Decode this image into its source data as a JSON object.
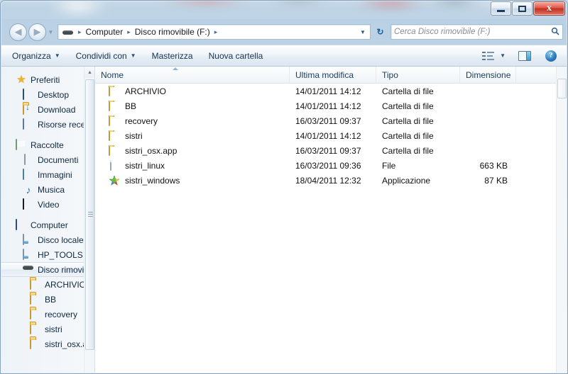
{
  "window": {
    "controls": {
      "minimize": "—",
      "maximize": "□",
      "close": "x"
    }
  },
  "address_bar": {
    "back_icon": "◀",
    "forward_icon": "▶",
    "history_caret": "▼",
    "drive_icon": "usb-drive-icon",
    "crumbs": [
      {
        "label": "Computer"
      },
      {
        "label": "Disco rimovibile (F:)"
      }
    ],
    "separator": "▸",
    "dropdown_caret": "▼",
    "refresh_icon": "↻"
  },
  "search": {
    "placeholder": "Cerca Disco rimovibile (F:)",
    "icon": "🔍"
  },
  "toolbar": {
    "items": [
      {
        "label": "Organizza",
        "caret": "▼"
      },
      {
        "label": "Condividi con",
        "caret": "▼"
      },
      {
        "label": "Masterizza",
        "caret": ""
      },
      {
        "label": "Nuova cartella",
        "caret": ""
      }
    ],
    "views_caret": "▼",
    "help_glyph": "?"
  },
  "navigation_pane": {
    "groups": [
      {
        "head": {
          "label": "Preferiti",
          "icon": "star-icon"
        },
        "children": [
          {
            "label": "Desktop",
            "icon": "desktop-icon"
          },
          {
            "label": "Download",
            "icon": "download-folder-icon"
          },
          {
            "label": "Risorse recent",
            "icon": "recent-places-icon"
          }
        ]
      },
      {
        "head": {
          "label": "Raccolte",
          "icon": "libraries-icon"
        },
        "children": [
          {
            "label": "Documenti",
            "icon": "document-icon"
          },
          {
            "label": "Immagini",
            "icon": "picture-icon"
          },
          {
            "label": "Musica",
            "icon": "music-note-icon"
          },
          {
            "label": "Video",
            "icon": "video-icon"
          }
        ]
      },
      {
        "head": {
          "label": "Computer",
          "icon": "computer-icon"
        },
        "children": [
          {
            "label": "Disco locale (",
            "icon": "hard-disk-icon"
          },
          {
            "label": "HP_TOOLS (D",
            "icon": "hard-disk-icon"
          },
          {
            "label": "Disco rimovib",
            "icon": "usb-drive-icon",
            "selected": true
          }
        ],
        "subchildren": [
          {
            "label": "ARCHIVIO",
            "icon": "folder-icon"
          },
          {
            "label": "BB",
            "icon": "folder-icon"
          },
          {
            "label": "recovery",
            "icon": "folder-icon"
          },
          {
            "label": "sistri",
            "icon": "folder-icon"
          },
          {
            "label": "sistri_osx.ap",
            "icon": "folder-icon"
          }
        ]
      }
    ],
    "scroll_up": "▲",
    "scroll_down": "▼"
  },
  "file_list": {
    "columns": [
      {
        "label": "Nome",
        "sorted": "asc"
      },
      {
        "label": "Ultima modifica"
      },
      {
        "label": "Tipo"
      },
      {
        "label": "Dimensione"
      }
    ],
    "rows": [
      {
        "name": "ARCHIVIO",
        "modified": "14/01/2011 14:12",
        "type": "Cartella di file",
        "size": "",
        "icon": "folder-icon"
      },
      {
        "name": "BB",
        "modified": "14/01/2011 14:12",
        "type": "Cartella di file",
        "size": "",
        "icon": "folder-icon"
      },
      {
        "name": "recovery",
        "modified": "16/03/2011 09:37",
        "type": "Cartella di file",
        "size": "",
        "icon": "folder-icon"
      },
      {
        "name": "sistri",
        "modified": "14/01/2011 14:12",
        "type": "Cartella di file",
        "size": "",
        "icon": "folder-icon"
      },
      {
        "name": "sistri_osx.app",
        "modified": "16/03/2011 09:37",
        "type": "Cartella di file",
        "size": "",
        "icon": "folder-icon"
      },
      {
        "name": "sistri_linux",
        "modified": "16/03/2011 09:36",
        "type": "File",
        "size": "663 KB",
        "icon": "blank-file-icon"
      },
      {
        "name": "sistri_windows",
        "modified": "18/04/2011 12:32",
        "type": "Applicazione",
        "size": "87 KB",
        "icon": "application-star-icon"
      }
    ]
  },
  "colors": {
    "close_button": "#c03122",
    "accent": "#1f5c96",
    "folder": "#f7d270",
    "selection_border": "#cfdeea"
  }
}
